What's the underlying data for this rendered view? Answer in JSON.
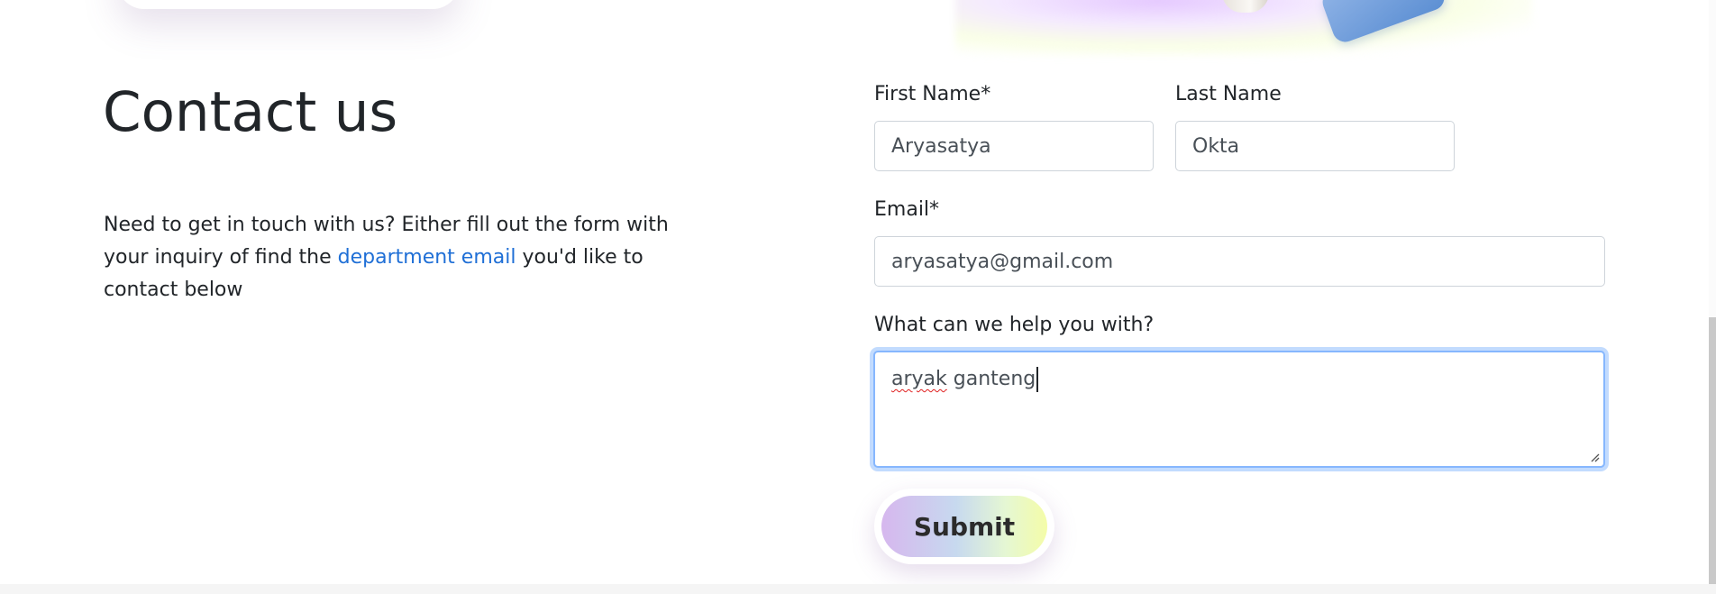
{
  "page": {
    "heading": "Contact us",
    "intro": {
      "before_link": "Need to get in touch with us? Either fill out the form with your inquiry of find the ",
      "link_text": "department email",
      "after_link": " you'd like to contact below"
    }
  },
  "form": {
    "first_name": {
      "label": "First Name*",
      "value": "Aryasatya"
    },
    "last_name": {
      "label": "Last Name",
      "value": "Okta"
    },
    "email": {
      "label": "Email*",
      "value": "aryasatya@gmail.com"
    },
    "message": {
      "label": "What can we help you with?",
      "value_misspelled": "aryak",
      "value_rest": " ganteng"
    },
    "submit_label": "Submit"
  },
  "colors": {
    "link": "#1f6fd6",
    "focus_ring": "#86b7fe",
    "button_gradient": [
      "#d6b7ee",
      "#c7d9ef",
      "#e5f7d3",
      "#f4fca8"
    ]
  }
}
